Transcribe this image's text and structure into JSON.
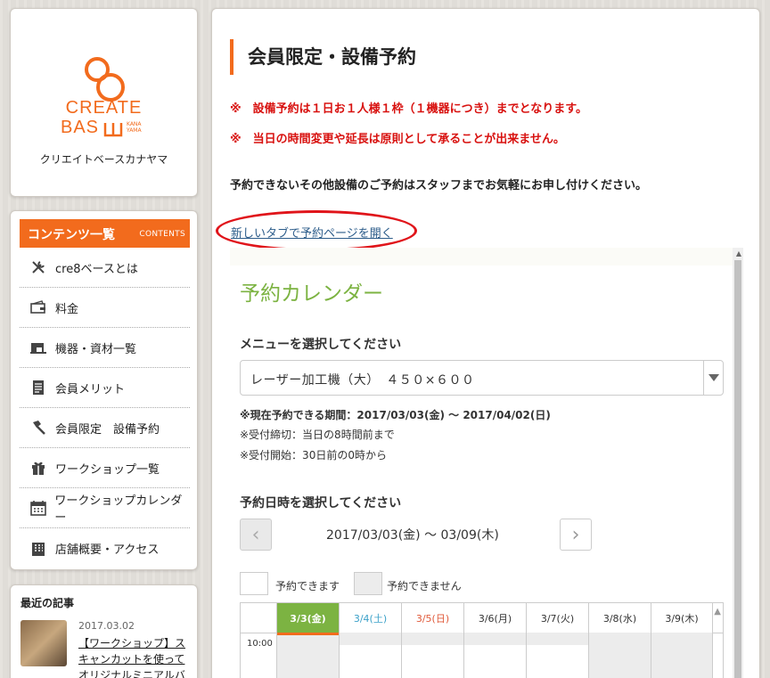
{
  "logo": {
    "line1": "CREATE",
    "line2": "BAS",
    "sub1": "KANA",
    "sub2": "YAMA",
    "name": "クリエイトベースカナヤマ",
    "color": "#f26b1d"
  },
  "nav": {
    "title": "コンテンツ一覧",
    "subtitle": "CONTENTS",
    "items": [
      {
        "label": "cre8ベースとは",
        "icon": "tools-icon"
      },
      {
        "label": "料金",
        "icon": "wallet-icon"
      },
      {
        "label": "機器・資材一覧",
        "icon": "sewing-machine-icon"
      },
      {
        "label": "会員メリット",
        "icon": "document-icon"
      },
      {
        "label": "会員限定　設備予約",
        "icon": "hammer-icon"
      },
      {
        "label": "ワークショップ一覧",
        "icon": "gift-icon"
      },
      {
        "label": "ワークショップカレンダー",
        "icon": "calendar-icon"
      },
      {
        "label": "店舗概要・アクセス",
        "icon": "building-icon"
      }
    ]
  },
  "recent": {
    "title": "最近の記事",
    "date": "2017.03.02",
    "link": "【ワークショップ】スキャンカットを使ってオリジナルミニアルバムを作ろう"
  },
  "main": {
    "title": "会員限定・設備予約",
    "notice1": "※　設備予約は１日お１人様１枠（１機器につき）までとなります。",
    "notice2": "※　当日の時間変更や延長は原則として承ることが出来ません。",
    "note": "予約できないその他設備のご予約はスタッフまでお気軽にお申し付けください。",
    "new_tab_link": "新しいタブで予約ページを開く"
  },
  "calendar": {
    "title": "予約カレンダー",
    "menu_label": "メニューを選択してください",
    "menu_value": "レーザー加工機（大）　４５０×６００",
    "period": "※現在予約できる期間：2017/03/03(金) ～ 2017/04/02(日)",
    "deadline": "※受付締切：当日の8時間前まで",
    "start": "※受付開始：30日前の0時から",
    "date_label": "予約日時を選択してください",
    "week_range": "2017/03/03(金) ～ 03/09(木)",
    "legend_available": "予約できます",
    "legend_unavailable": "予約できません",
    "days": [
      {
        "label": "3/3(金)",
        "type": "today"
      },
      {
        "label": "3/4(土)",
        "type": "sat"
      },
      {
        "label": "3/5(日)",
        "type": "sun"
      },
      {
        "label": "3/6(月)",
        "type": "normal"
      },
      {
        "label": "3/7(火)",
        "type": "normal"
      },
      {
        "label": "3/8(水)",
        "type": "normal"
      },
      {
        "label": "3/9(木)",
        "type": "normal"
      }
    ],
    "time_first": "10:00",
    "colors": {
      "accent": "#7cb342",
      "sat": "#3aa0c8",
      "sun": "#e05a3a",
      "unavailable": "#ececec",
      "today_bar": "#f26b1d"
    }
  }
}
